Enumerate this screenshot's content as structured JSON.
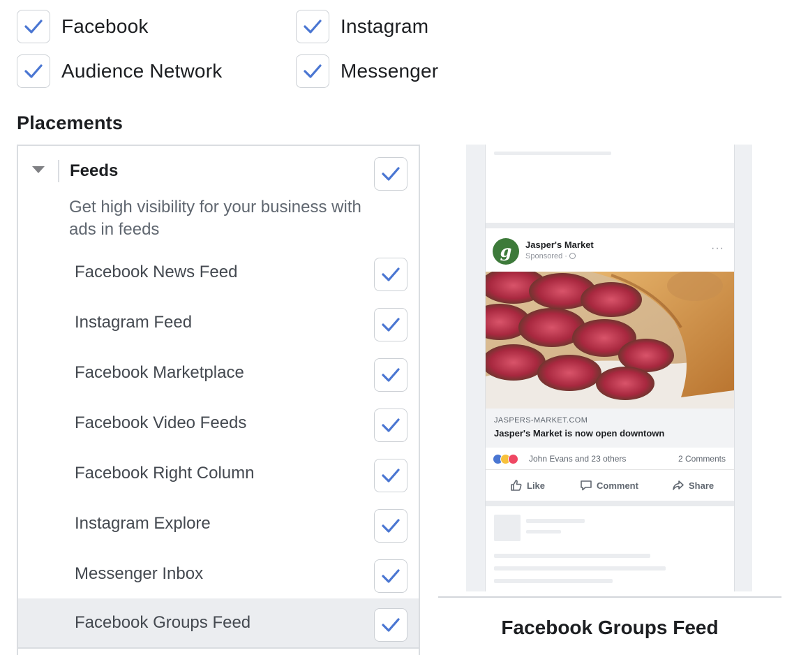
{
  "platforms": [
    {
      "label": "Facebook",
      "checked": true
    },
    {
      "label": "Instagram",
      "checked": true
    },
    {
      "label": "Audience Network",
      "checked": true
    },
    {
      "label": "Messenger",
      "checked": true
    }
  ],
  "placements": {
    "title": "Placements",
    "group": {
      "title": "Feeds",
      "description": "Get high visibility for your business with ads in feeds",
      "checked": true,
      "expanded": true
    },
    "items": [
      {
        "label": "Facebook News Feed",
        "checked": true
      },
      {
        "label": "Instagram Feed",
        "checked": true
      },
      {
        "label": "Facebook Marketplace",
        "checked": true
      },
      {
        "label": "Facebook Video Feeds",
        "checked": true
      },
      {
        "label": "Facebook Right Column",
        "checked": true
      },
      {
        "label": "Instagram Explore",
        "checked": true
      },
      {
        "label": "Messenger Inbox",
        "checked": true
      },
      {
        "label": "Facebook Groups Feed",
        "checked": true,
        "selected": true
      }
    ]
  },
  "preview": {
    "page_name": "Jasper's Market",
    "avatar_letter": "g",
    "sponsored": "Sponsored ·",
    "more": "···",
    "link_domain": "JASPERS-MARKET.COM",
    "link_title": "Jasper's Market is now open downtown",
    "reactions_text": "John Evans and 23 others",
    "comments_text": "2 Comments",
    "actions": {
      "like": "Like",
      "comment": "Comment",
      "share": "Share"
    },
    "caption": "Facebook Groups Feed"
  },
  "colors": {
    "check": "#4a76d2",
    "selected_row": "#ebedf0",
    "avatar": "#3d7a3a"
  }
}
